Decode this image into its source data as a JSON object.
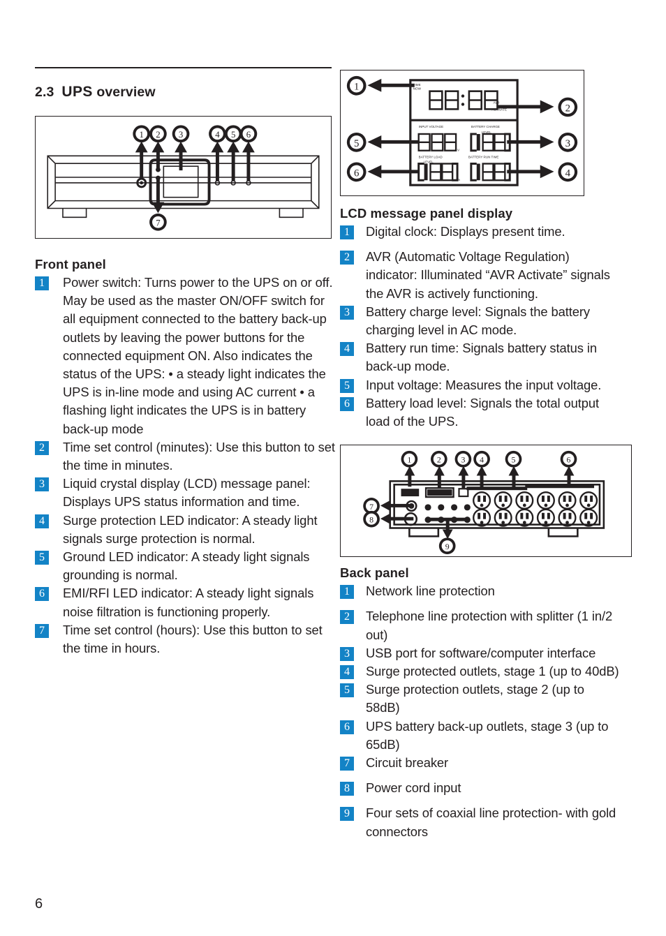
{
  "page": {
    "number": "6"
  },
  "heading": {
    "number": "2.3",
    "title_strong": "UPS",
    "title_rest": " overview"
  },
  "front_panel": {
    "heading": "Front panel",
    "figure_caption_numbers": [
      "1",
      "2",
      "3",
      "4",
      "5",
      "6",
      "7"
    ],
    "items": [
      {
        "n": "1",
        "text": "Power switch: Turns power to the UPS on or off. May be used as the master ON/OFF switch for all equipment connected to the battery back-up outlets by leaving the power buttons for the connected equipment ON. Also indicates the status of the UPS: • a steady light indicates the UPS is in-line mode and using AC current • a flashing light indicates the UPS is in battery back-up mode"
      },
      {
        "n": "2",
        "text": "Time set control (minutes): Use this button to set the time in minutes."
      },
      {
        "n": "3",
        "text": "Liquid crystal display (LCD) message panel: Displays UPS status information and time."
      },
      {
        "n": "4",
        "text": "Surge protection LED indicator: A steady light signals surge protection is normal."
      },
      {
        "n": "5",
        "text": "Ground LED indicator: A steady light signals grounding is normal."
      },
      {
        "n": "6",
        "text": "EMI/RFI LED indicator: A steady light signals noise filtration is functioning properly."
      },
      {
        "n": "7",
        "text": "Time set control (hours): Use this button to set the time in hours."
      }
    ]
  },
  "lcd_panel": {
    "heading": "LCD message panel display",
    "figure_labels": {
      "time_now": "TIME NOW",
      "avr_activate": "AVR ACTIVATE",
      "input_voltage": "INPUT VOLTAGE",
      "battery_charge": "BATTERY CHARGE",
      "battery_charge_level": "LEVEL",
      "battery_load": "BATTERY LOAD",
      "battery_load_level": "LEVEL",
      "battery_run_time": "BATTERY RUN TIME",
      "unit_volts": "V",
      "unit_percent": "%",
      "unit_minutes": "M",
      "clock_digits": "88:88",
      "voltage_digits": "888",
      "charge_digits": "188",
      "load_digits": "188",
      "runtime_digits": "188"
    },
    "figure_caption_numbers": [
      "1",
      "2",
      "3",
      "4",
      "5",
      "6"
    ],
    "items": [
      {
        "n": "1",
        "text": "Digital clock: Displays present time."
      },
      {
        "n": "2",
        "text": "AVR (Automatic Voltage Regulation) indicator: Illuminated “AVR Activate” signals the AVR is actively functioning."
      },
      {
        "n": "3",
        "text": "Battery charge level: Signals the battery charging level in AC mode."
      },
      {
        "n": "4",
        "text": "Battery run time: Signals battery status in back-up mode."
      },
      {
        "n": "5",
        "text": "Input voltage: Measures the input voltage."
      },
      {
        "n": "6",
        "text": "Battery load level: Signals the total output load of the UPS."
      }
    ]
  },
  "back_panel": {
    "heading": "Back panel",
    "figure_caption_numbers": [
      "1",
      "2",
      "3",
      "4",
      "5",
      "6",
      "7",
      "8",
      "9"
    ],
    "items": [
      {
        "n": "1",
        "text": "Network line protection"
      },
      {
        "n": "2",
        "text": "Telephone line protection with splitter (1 in/2 out)"
      },
      {
        "n": "3",
        "text": "USB port for software/computer interface"
      },
      {
        "n": "4",
        "text": "Surge protected outlets, stage 1 (up to 40dB)"
      },
      {
        "n": "5",
        "text": "Surge protection outlets, stage 2 (up to 58dB)"
      },
      {
        "n": "6",
        "text": "UPS battery back-up outlets, stage 3 (up to 65dB)"
      },
      {
        "n": "7",
        "text": "Circuit breaker"
      },
      {
        "n": "8",
        "text": "Power cord input"
      },
      {
        "n": "9",
        "text": "Four sets of coaxial line protection- with gold connectors"
      }
    ]
  },
  "colors": {
    "badge_blue": "#1383c6",
    "ink": "#231f20",
    "paper": "#ffffff"
  }
}
